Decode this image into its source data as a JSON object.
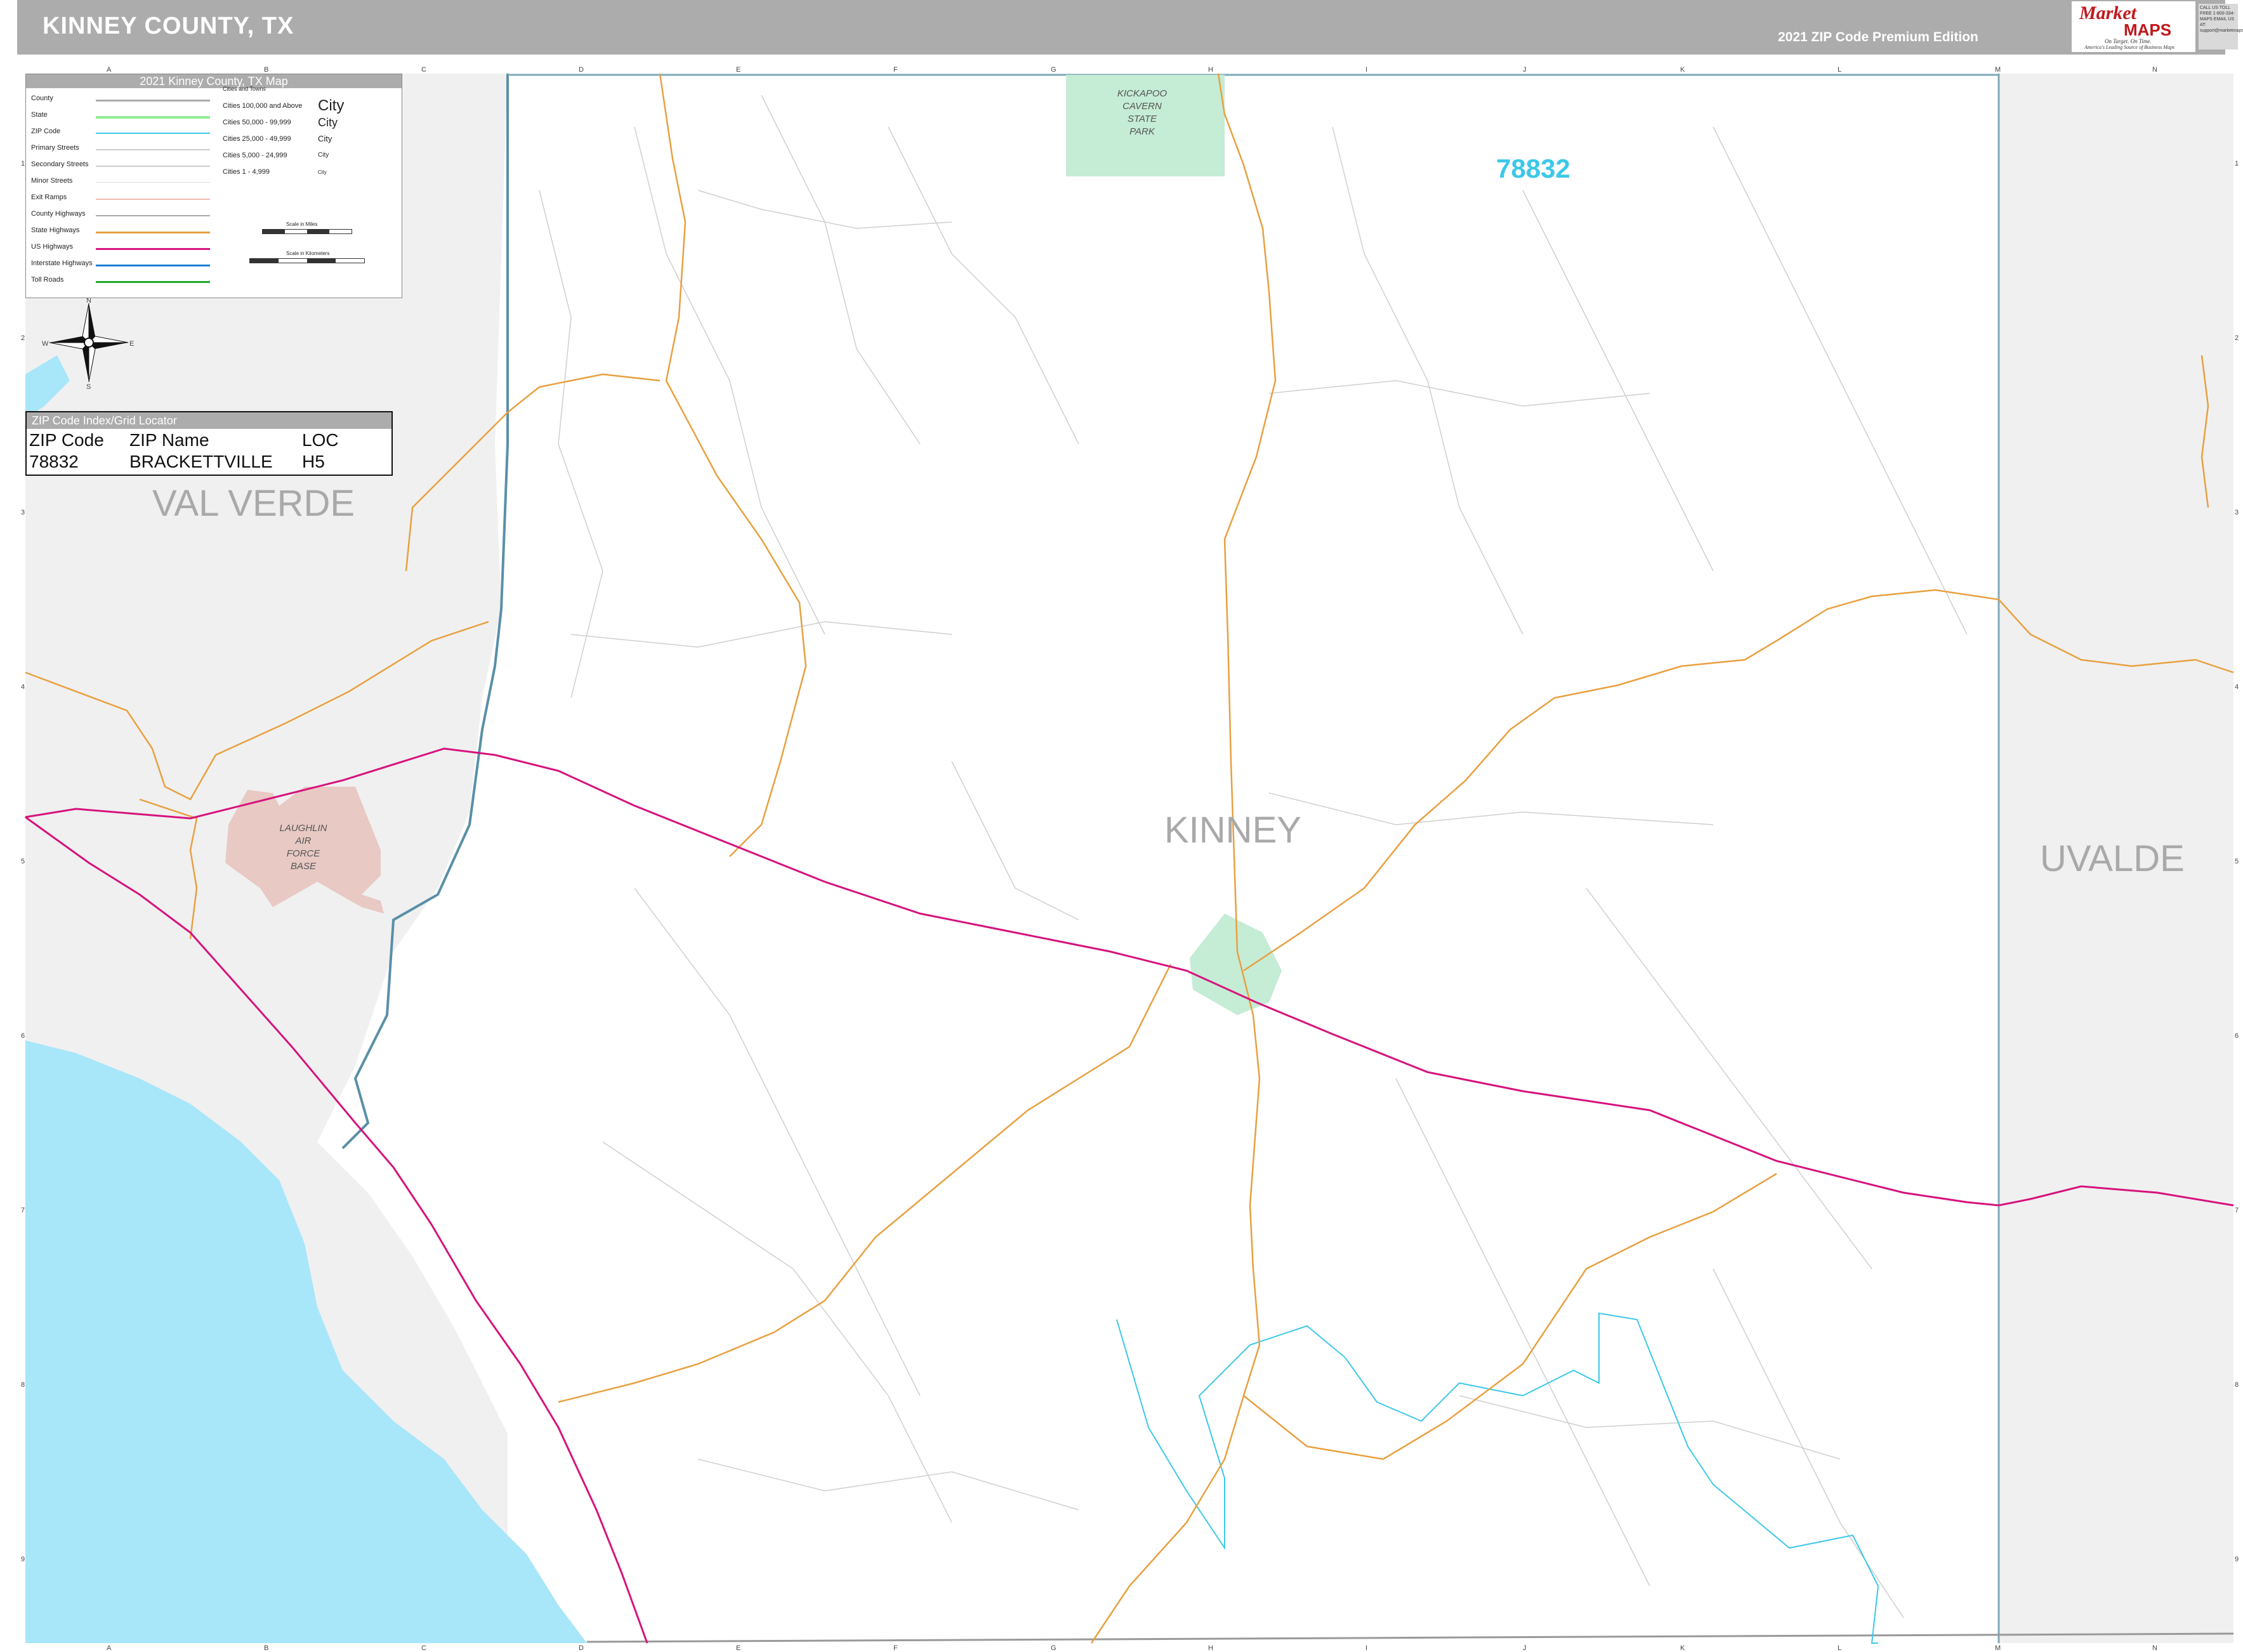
{
  "header": {
    "title": "KINNEY COUNTY, TX",
    "edition": "2021 ZIP Code Premium Edition"
  },
  "logo": {
    "market": "Market",
    "maps": "MAPS",
    "tagline": "On Target. On Time.",
    "tagline2": "America's Leading Source of Business Maps",
    "contact": "CALL US TOLL FREE 1-800-334-MAPS EMAIL US AT: support@marketmaps.com"
  },
  "legend": {
    "title": "2021 Kinney County, TX Map",
    "items": [
      "County",
      "State",
      "ZIP Code",
      "Primary Streets",
      "Secondary Streets",
      "Minor Streets",
      "Exit Ramps",
      "County Highways",
      "State Highways",
      "US Highways",
      "Interstate Highways",
      "Toll Roads"
    ],
    "cities_header": "Cities and Towns",
    "cities": [
      "Cities 100,000 and Above",
      "Cities 50,000 - 99,999",
      "Cities 25,000 - 49,999",
      "Cities 5,000 - 24,999",
      "Cities 1 - 4,999"
    ],
    "city_samples": [
      "City",
      "City",
      "City",
      "City",
      "City"
    ],
    "scale_miles": "Scale in Miles",
    "scale_km": "Scale in Kilometers"
  },
  "zip_index": {
    "title": "ZIP Code Index/Grid Locator",
    "headers": [
      "ZIP Code",
      "ZIP Name",
      "LOC"
    ],
    "rows": [
      [
        "78832",
        "BRACKETTVILLE",
        "H5"
      ]
    ]
  },
  "map": {
    "counties": {
      "west": "VAL VERDE",
      "center": "KINNEY",
      "east": "UVALDE"
    },
    "zip_label": "78832",
    "park": [
      "KICKAPOO",
      "CAVERN",
      "STATE",
      "PARK"
    ],
    "base": [
      "LAUGHLIN",
      "AIR",
      "FORCE",
      "BASE"
    ],
    "compass": {
      "n": "N",
      "s": "S",
      "e": "E",
      "w": "W"
    },
    "grid_letters": [
      "A",
      "B",
      "C",
      "D",
      "E",
      "F",
      "G",
      "H",
      "I",
      "J",
      "K",
      "L",
      "M",
      "N"
    ],
    "grid_numbers": [
      "1",
      "2",
      "3",
      "4",
      "5",
      "6",
      "7",
      "8",
      "9"
    ]
  },
  "colors": {
    "header": "#acacac",
    "water": "#a8e6fa",
    "us_highway": "#d6137d",
    "state_highway": "#e8a040",
    "zip_boundary": "#3cc8e8",
    "park": "#c5ecd5",
    "military": "#e8c9c4",
    "outside_county": "#f0f0f0",
    "county_line": "#5a8fa8"
  }
}
